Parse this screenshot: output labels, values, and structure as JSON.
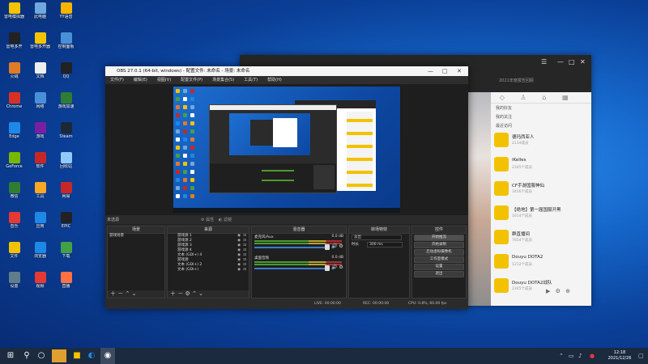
{
  "colors": {
    "accent": "#1565c8",
    "obs_bg": "#2b2b2b",
    "chat_icon": "#f2c200",
    "taskbar": "#1b2a3f"
  },
  "desktop_icons": [
    {
      "label": "雷电模拟器",
      "icon": "game-icon",
      "color": "#f5c400"
    },
    {
      "label": "此电脑",
      "icon": "computer-icon",
      "color": "#6fa8dc"
    },
    {
      "label": "YY语音",
      "icon": "yy-icon",
      "color": "#f4b400"
    },
    {
      "label": "雷电多开",
      "icon": "app-icon",
      "color": "#222"
    },
    {
      "label": "雷电多开器",
      "icon": "app-icon",
      "color": "#f5c400"
    },
    {
      "label": "控制面板",
      "icon": "control-panel-icon",
      "color": "#4a90d9"
    },
    {
      "label": "火绒",
      "icon": "shield-icon",
      "color": "#e07b28"
    },
    {
      "label": "文档",
      "icon": "document-icon",
      "color": "#eee"
    },
    {
      "label": "QQ",
      "icon": "qq-icon",
      "color": "#222"
    },
    {
      "label": "Chrome",
      "icon": "chrome-icon",
      "color": "#d93025"
    },
    {
      "label": "网络",
      "icon": "network-icon",
      "color": "#4a90d9"
    },
    {
      "label": "游戏加速",
      "icon": "app-icon",
      "color": "#2e7d32"
    },
    {
      "label": "Edge",
      "icon": "edge-icon",
      "color": "#1e88e5"
    },
    {
      "label": "游戏",
      "icon": "game-icon",
      "color": "#7b1fa2"
    },
    {
      "label": "Steam",
      "icon": "steam-icon",
      "color": "#1b2838"
    },
    {
      "label": "GeForce",
      "icon": "nvidia-icon",
      "color": "#76b900"
    },
    {
      "label": "软件",
      "icon": "app-icon",
      "color": "#c62828"
    },
    {
      "label": "回收站",
      "icon": "recycle-bin-icon",
      "color": "#90caf9"
    },
    {
      "label": "微信",
      "icon": "wechat-icon",
      "color": "#2e7d32"
    },
    {
      "label": "工具",
      "icon": "app-icon",
      "color": "#f9a825"
    },
    {
      "label": "网易",
      "icon": "app-icon",
      "color": "#c62828"
    },
    {
      "label": "音乐",
      "icon": "music-icon",
      "color": "#e53935"
    },
    {
      "label": "应用",
      "icon": "app-icon",
      "color": "#1e88e5"
    },
    {
      "label": "EPIC",
      "icon": "epic-icon",
      "color": "#222"
    },
    {
      "label": "文件",
      "icon": "folder-icon",
      "color": "#f2c200"
    },
    {
      "label": "浏览器",
      "icon": "ie-icon",
      "color": "#1e88e5"
    },
    {
      "label": "下载",
      "icon": "download-icon",
      "color": "#43a047"
    },
    {
      "label": "设置",
      "icon": "gear-icon",
      "color": "#607d8b"
    },
    {
      "label": "视频",
      "icon": "video-icon",
      "color": "#e53935"
    },
    {
      "label": "直播",
      "icon": "live-icon",
      "color": "#ff7043"
    }
  ],
  "chat": {
    "header_text": "2021年度报告回顾",
    "sections": {
      "mine": "我的好友",
      "fans": "我的关注",
      "recent": "最近访问"
    },
    "items": [
      {
        "title": "德玛西亚人",
        "sub": "2114成员"
      },
      {
        "title": "iKelles",
        "sub": "2345个成员"
      },
      {
        "title": "CF手游国服神仙",
        "sub": "3456个成员"
      },
      {
        "title": "【绝地】第一届国服开黑",
        "sub": "1614个成员"
      },
      {
        "title": "群直播间",
        "sub": "7654个成员"
      },
      {
        "title": "Douyu DOTA2",
        "sub": "1212个成员"
      },
      {
        "title": "Douyu DOTA2战队",
        "sub": "2345个成员"
      }
    ]
  },
  "obs": {
    "title": "OBS 27.0.1 (64-bit, windows) - 配置文件: 未命名 - 场景: 未命名",
    "menu": [
      "文件(F)",
      "编辑(E)",
      "视图(V)",
      "配置文件(P)",
      "场景集合(S)",
      "工具(T)",
      "帮助(H)"
    ],
    "ctrlbar_label": "未选源",
    "ctrlbar_props": "属性",
    "ctrlbar_filters": "滤镜",
    "panels": {
      "scenes": "场景",
      "sources": "来源",
      "mixer": "混音器",
      "transitions": "转场特效",
      "controls": "控件"
    },
    "scenes": [
      "游戏场景"
    ],
    "sources": [
      "游戏源 1",
      "游戏源 2",
      "游戏源 3",
      "游戏源 4",
      "文本 (GDI+) 4",
      "游戏源",
      "文本 (GDI+) 2",
      "文本 (GDI+)"
    ],
    "mixer_tracks": [
      {
        "name": "麦克风/Aux",
        "db": "0.0 dB"
      },
      {
        "name": "桌面音频",
        "db": "0.0 dB"
      }
    ],
    "transition": {
      "type": "淡出",
      "duration_label": "时长",
      "duration": "300 ms"
    },
    "controls": [
      "开始推流",
      "开始录制",
      "启动虚拟摄像机",
      "工作室模式",
      "设置",
      "退出"
    ],
    "status": {
      "live": "LIVE: 00:00:00",
      "rec": "REC: 00:00:00",
      "cpu": "CPU: 0.8%, 60.00 fps"
    }
  },
  "taskbar": {
    "time": "12:18",
    "date": "2021/12/26"
  }
}
